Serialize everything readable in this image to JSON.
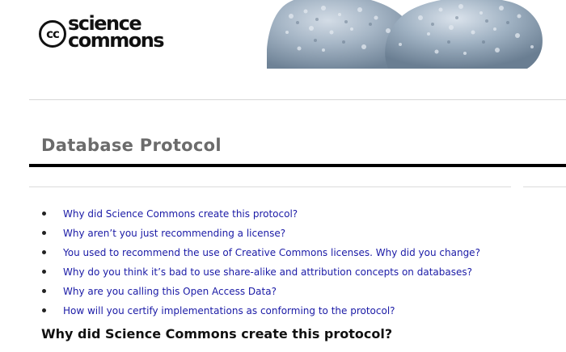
{
  "header": {
    "logo_cc": "cc",
    "logo_line1": "science",
    "logo_line2": "commons"
  },
  "page": {
    "title": "Database Protocol"
  },
  "faq_links": [
    "Why did Science Commons create this protocol?",
    "Why aren’t you just recommending a license?",
    "You used to recommend the use of Creative Commons licenses. Why did you change?",
    "Why do you think it’s bad to use share-alike and attribution concepts on databases?",
    "Why are you calling this Open Access Data?",
    "How will you certify implementations as conforming to the protocol?"
  ],
  "section": {
    "heading": "Why did Science Commons create this protocol?"
  },
  "colors": {
    "link": "#1a1aa6",
    "title": "#6b6b6b",
    "banner": "#8fa4b8"
  }
}
